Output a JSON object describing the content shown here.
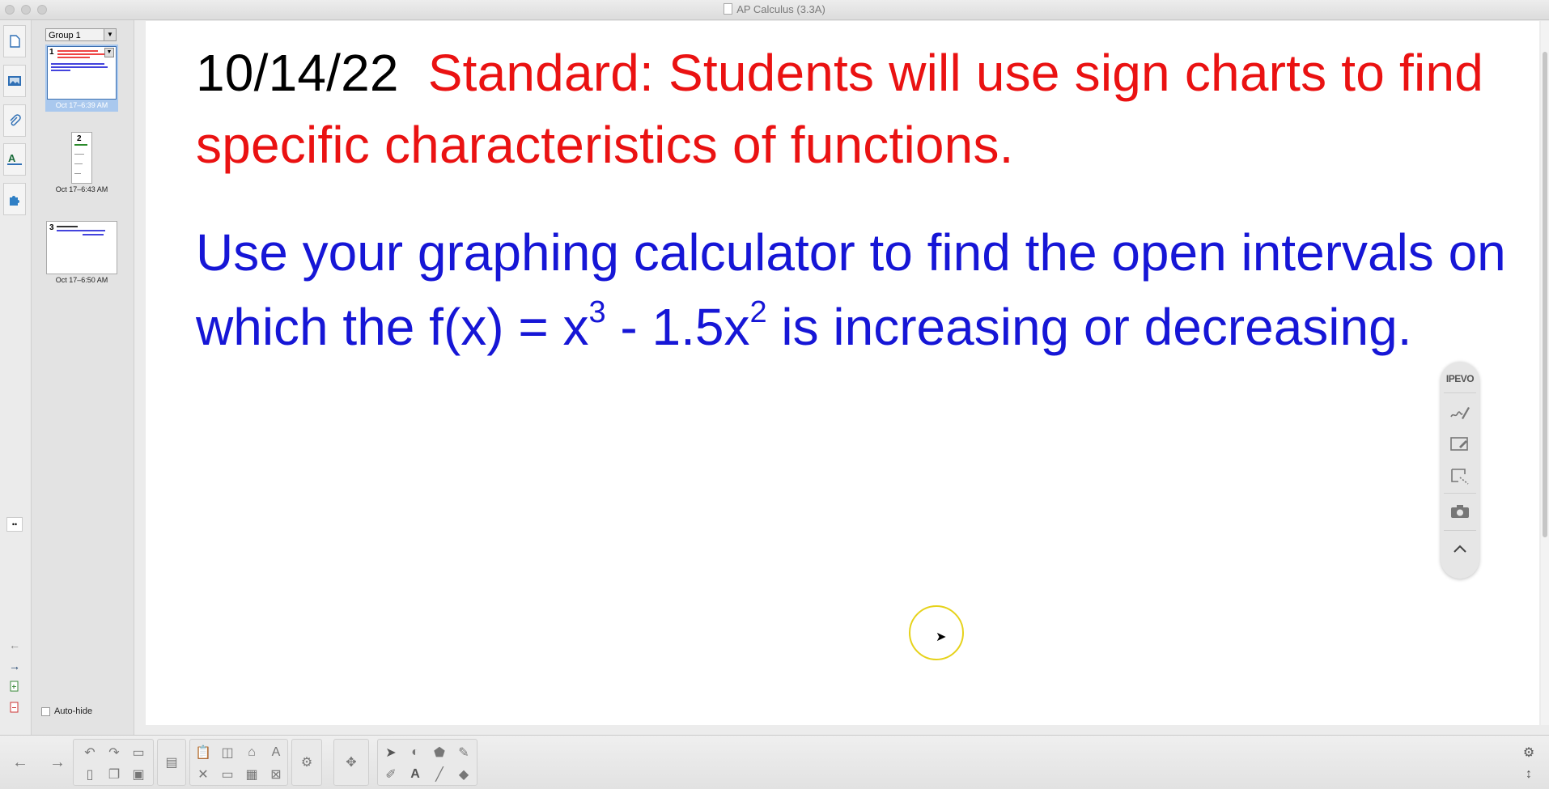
{
  "window": {
    "title": "AP Calculus (3.3A)"
  },
  "left_strip": {
    "tabs": [
      "page-sorter-icon",
      "gallery-icon",
      "attachments-icon",
      "properties-icon",
      "addons-icon"
    ],
    "collapse_label": "••"
  },
  "sorter": {
    "group_label": "Group 1",
    "pages": [
      {
        "number": "1",
        "label": "Oct 17–6:39 AM",
        "selected": true
      },
      {
        "number": "2",
        "label": "Oct 17–6:43 AM",
        "selected": false
      },
      {
        "number": "3",
        "label": "Oct 17–6:50 AM",
        "selected": false
      }
    ],
    "auto_hide_label": "Auto-hide"
  },
  "slide": {
    "date": "10/14/22",
    "standard": "Standard: Students will use sign charts to find specific characteristics of functions.",
    "question_part1": "Use your graphing calculator to find the open intervals on which the f(x) = x",
    "exp1": "3",
    "question_part2": " - 1.5x",
    "exp2": "2",
    "question_part3": " is increasing or decreasing."
  },
  "ipevo": {
    "logo": "IPEVO"
  },
  "colors": {
    "date": "#000000",
    "standard": "#ea1212",
    "question": "#1616d6",
    "cursor_ring": "#e6d21a"
  }
}
